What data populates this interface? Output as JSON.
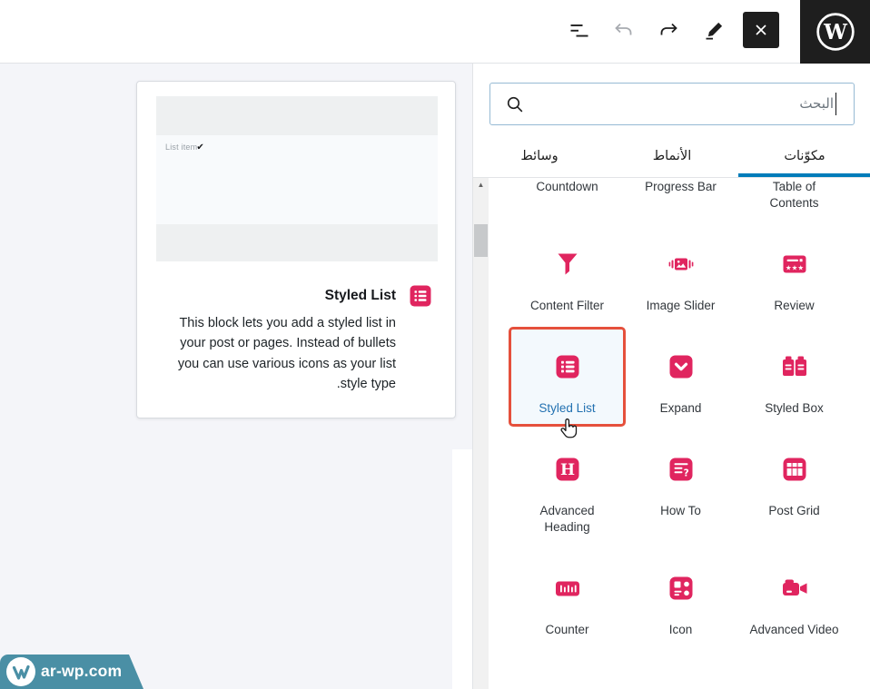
{
  "header": {
    "toolbar": {
      "list_view": "list-view",
      "undo": "undo",
      "redo": "redo",
      "edit": "edit-pencil",
      "close": "close"
    },
    "logo": "wordpress"
  },
  "panel": {
    "search": {
      "placeholder": "البحث"
    },
    "tabs": [
      {
        "label": "وسائط",
        "active": false
      },
      {
        "label": "الأنماط",
        "active": false
      },
      {
        "label": "مكوّنات",
        "active": true
      }
    ],
    "blocks": [
      {
        "label": "Countdown",
        "icon": "countdown-icon"
      },
      {
        "label": "Progress Bar",
        "icon": "progress-bar-icon"
      },
      {
        "label": "Table of Contents",
        "icon": "table-of-contents-icon"
      },
      {
        "label": "Content Filter",
        "icon": "content-filter-icon"
      },
      {
        "label": "Image Slider",
        "icon": "image-slider-icon"
      },
      {
        "label": "Review",
        "icon": "review-icon"
      },
      {
        "label": "Styled List",
        "icon": "styled-list-icon",
        "selected": true
      },
      {
        "label": "Expand",
        "icon": "expand-icon"
      },
      {
        "label": "Styled Box",
        "icon": "styled-box-icon"
      },
      {
        "label": "Advanced Heading",
        "icon": "advanced-heading-icon"
      },
      {
        "label": "How To",
        "icon": "how-to-icon"
      },
      {
        "label": "Post Grid",
        "icon": "post-grid-icon"
      },
      {
        "label": "Counter",
        "icon": "counter-icon"
      },
      {
        "label": "Icon",
        "icon": "icon-block-icon"
      },
      {
        "label": "Advanced Video",
        "icon": "advanced-video-icon"
      }
    ]
  },
  "preview": {
    "title": "Styled List",
    "description": "This block lets you add a styled list in your post or pages. Instead of bullets you can use various icons as your list style type.",
    "sample_item": "List item",
    "check_glyph": "✔"
  },
  "badge": {
    "text": "ar-wp.com"
  },
  "colors": {
    "accent_pink": "#e0255f",
    "selection_ring": "#e5503c",
    "active_tab": "#007cba",
    "selected_label": "#2271b1",
    "badge_teal": "#4a8fa5",
    "header_dark": "#1e1e1e",
    "canvas_bg": "#f4f5f9"
  }
}
